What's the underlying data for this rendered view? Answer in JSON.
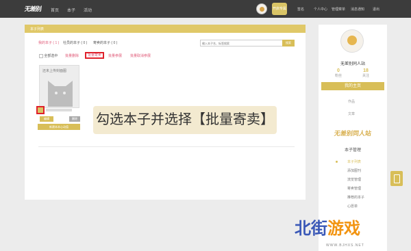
{
  "nav": {
    "logo": "无差别",
    "links": [
      "首页",
      "本子",
      "活动"
    ],
    "vip_label": "开启专属",
    "right_links": [
      "签名",
      "个人中心",
      "管理菜单",
      "消息通知",
      "退出"
    ]
  },
  "main": {
    "header_title": "本子列表",
    "tabs": [
      "我的本子 ( 1 )",
      "社员的本子 ( 0 )",
      "寄卖的本子 ( 0 )"
    ],
    "search_placeholder": "输入本子名、标签搜索",
    "search_button": "搜索",
    "select_all": "全部选中",
    "actions": [
      "批量删除",
      "批量寄卖",
      "批量参展",
      "批量取消参展"
    ],
    "card_label": "还未上传封面图",
    "card_buttons": [
      "编辑",
      "删除"
    ],
    "card_wide_button": "新建本本心动值"
  },
  "caption": "勾选本子并选择【批量寄卖】",
  "sidebar": {
    "name": "无差别同人站",
    "stats": [
      {
        "value": "0",
        "label": "粉丝"
      },
      {
        "value": "18",
        "label": "关注"
      }
    ],
    "home_button": "我的主页",
    "meta": [
      "作品",
      "文章"
    ],
    "logo": "无差别同人站",
    "section_title": "本子管理",
    "menu": [
      "本子列表",
      "添加图刊",
      "流览管理",
      "寄卖管理",
      "推荐的本子",
      "心愿单"
    ]
  },
  "watermark": {
    "main": "北街",
    "accent": "游戏",
    "sub": "WWW.BJHXS.NET"
  },
  "colors": {
    "accent": "#d8be58",
    "highlight": "#e0202a",
    "link": "#e05a78"
  }
}
